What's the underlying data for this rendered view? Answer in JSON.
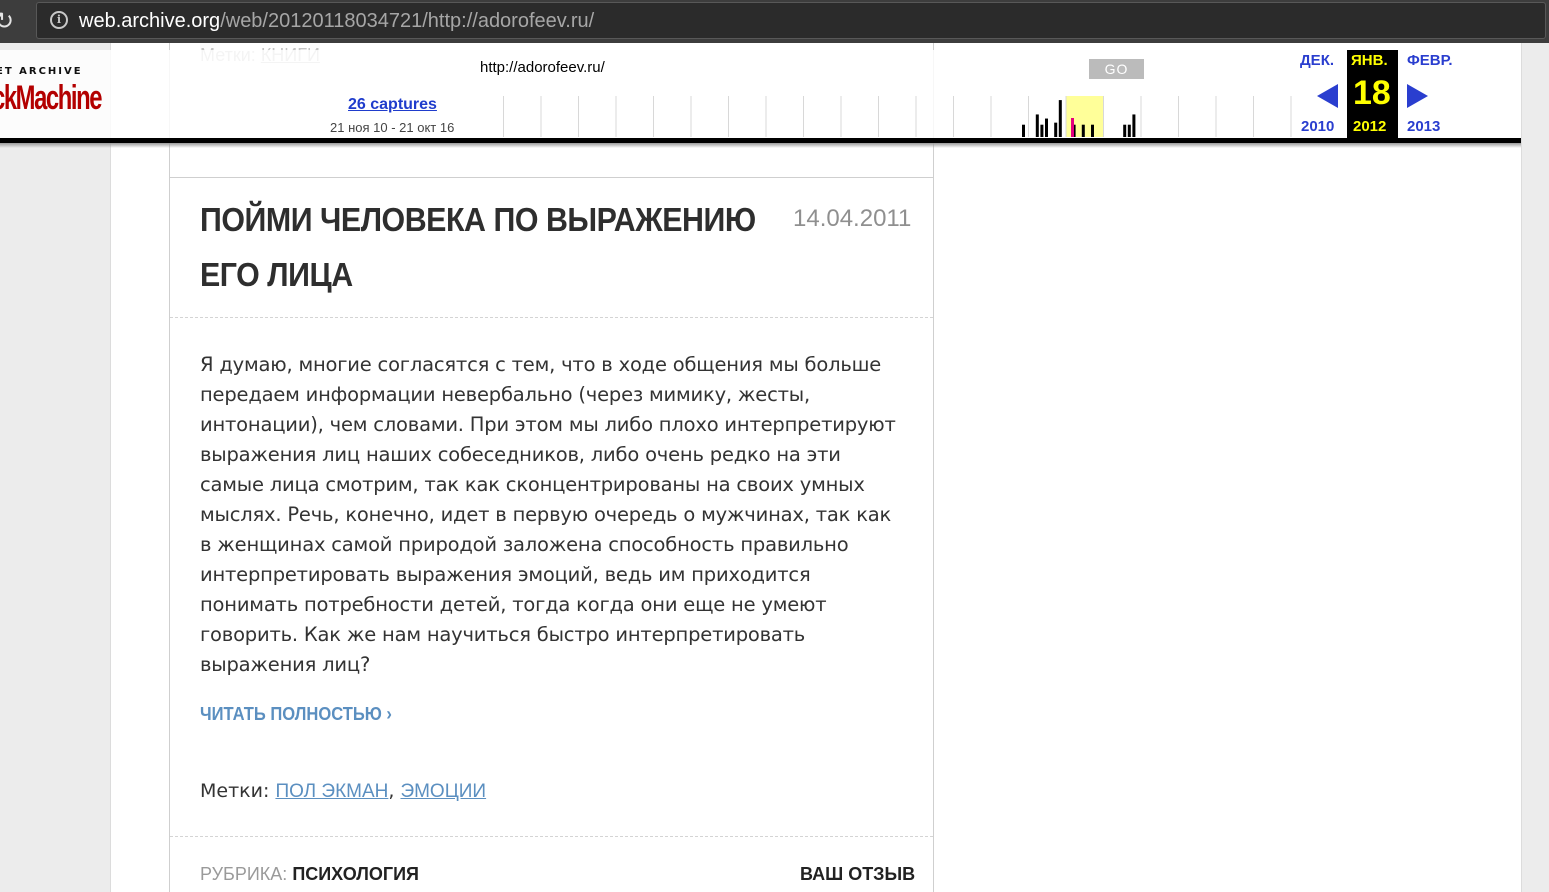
{
  "browser": {
    "url_host": "web.archive.org",
    "url_path": "/web/20120118034721/http://adorofeev.ru/"
  },
  "wayback": {
    "logo_top": "ET ARCHIVE",
    "logo_main": "ckMachine",
    "url": "http://adorofeev.ru/",
    "go": "GO",
    "captures": "26 captures",
    "range": "21 ноя 10 - 21 окт 16",
    "prev_month": "ДЕК.",
    "cur_month": "ЯНВ.",
    "next_month": "ФЕВР.",
    "cur_day": "18",
    "prev_year": "2010",
    "cur_year": "2012",
    "next_year": "2013",
    "sparkline_heights": [
      0,
      0,
      0,
      0,
      0,
      0,
      0,
      0,
      0,
      0,
      0,
      0,
      0,
      0,
      0,
      0,
      0,
      0,
      0,
      0,
      0,
      0,
      0,
      0,
      0,
      0,
      0,
      0,
      0,
      0,
      0,
      0,
      0,
      0,
      0,
      0,
      0.3,
      0,
      0,
      0.55,
      0.3,
      0.45,
      0,
      0.35,
      0.9,
      0,
      0,
      0.3,
      0,
      0.3,
      0,
      0.3,
      0,
      0,
      0,
      0,
      0,
      0,
      0.3,
      0.3,
      0.55
    ],
    "accent_color": "#2a3ecf",
    "highlight_color": "#ffff00"
  },
  "post": {
    "prev_tags_label": "Метки:",
    "prev_tags_link": "КНИГИ",
    "title": "ПОЙМИ ЧЕЛОВЕКА ПО ВЫРАЖЕНИЮ ЕГО ЛИЦА",
    "date": "14.04.2011",
    "body": "Я думаю, многие согласятся с тем, что в ходе общения мы больше передаем информации невербально (через мимику, жесты, интонации), чем словами. При этом мы либо плохо интерпретируют выражения лиц наших собеседников, либо очень редко на эти самые лица смотрим, так как сконцентрированы на  своих умных мыслях. Речь, конечно, идет в первую очередь о мужчинах, так как в женщинах самой природой заложена способность правильно интерпретировать выражения эмоций, ведь им приходится понимать потребности детей, тогда когда они еще  не умеют говорить. Как же нам научиться быстро интерпретировать выражения лиц?",
    "read_more": "ЧИТАТЬ ПОЛНОСТЬЮ ›",
    "tags_label": "Метки:",
    "tag1": "ПОЛ ЭКМАН",
    "tag2": "ЭМОЦИИ",
    "rubric_label": "РУБРИКА:",
    "rubric_value": "ПСИХОЛОГИЯ",
    "review": "ВАШ ОТЗЫВ",
    "link_color": "#5b8fc0"
  }
}
